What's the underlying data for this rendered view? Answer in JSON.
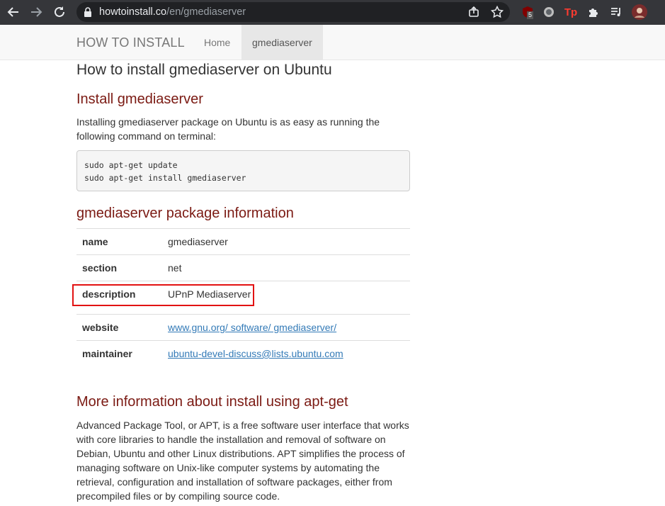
{
  "browser": {
    "url_host": "howtoinstall.co",
    "url_path": "/en/gmediaserver",
    "ublock_badge": "5",
    "extension_tp_label": "Tp"
  },
  "navbar": {
    "brand": "HOW TO INSTALL",
    "home": "Home",
    "active": "gmediaserver"
  },
  "page": {
    "title": "How to install gmediaserver on Ubuntu",
    "install_heading": "Install gmediaserver",
    "install_text": "Installing gmediaserver package on Ubuntu is as easy as running the following command on terminal:",
    "command_lines": [
      "sudo apt-get update",
      "sudo apt-get install gmediaserver"
    ],
    "info_heading": "gmediaserver package information",
    "info_rows": [
      {
        "key": "name",
        "value": "gmediaserver"
      },
      {
        "key": "section",
        "value": "net"
      },
      {
        "key": "description",
        "value": "UPnP Mediaserver"
      },
      {
        "key": "website",
        "value": "www.gnu.org/ software/ gmediaserver/"
      },
      {
        "key": "maintainer",
        "value": "ubuntu-devel-discuss@lists.ubuntu.com"
      }
    ],
    "more_heading": "More information about install using apt-get",
    "more_text": "Advanced Package Tool, or APT, is a free software user interface that works with core libraries to handle the installation and removal of software on Debian, Ubuntu and other Linux distributions. APT simplifies the process of managing software on Unix-like computer systems by automating the retrieval, configuration and installation of software packages, either from precompiled files or by compiling source code."
  },
  "colors": {
    "heading_red": "#7b1a13",
    "link_blue": "#337ab7",
    "highlight_red": "#e21212",
    "chrome_dark": "#35363a"
  }
}
